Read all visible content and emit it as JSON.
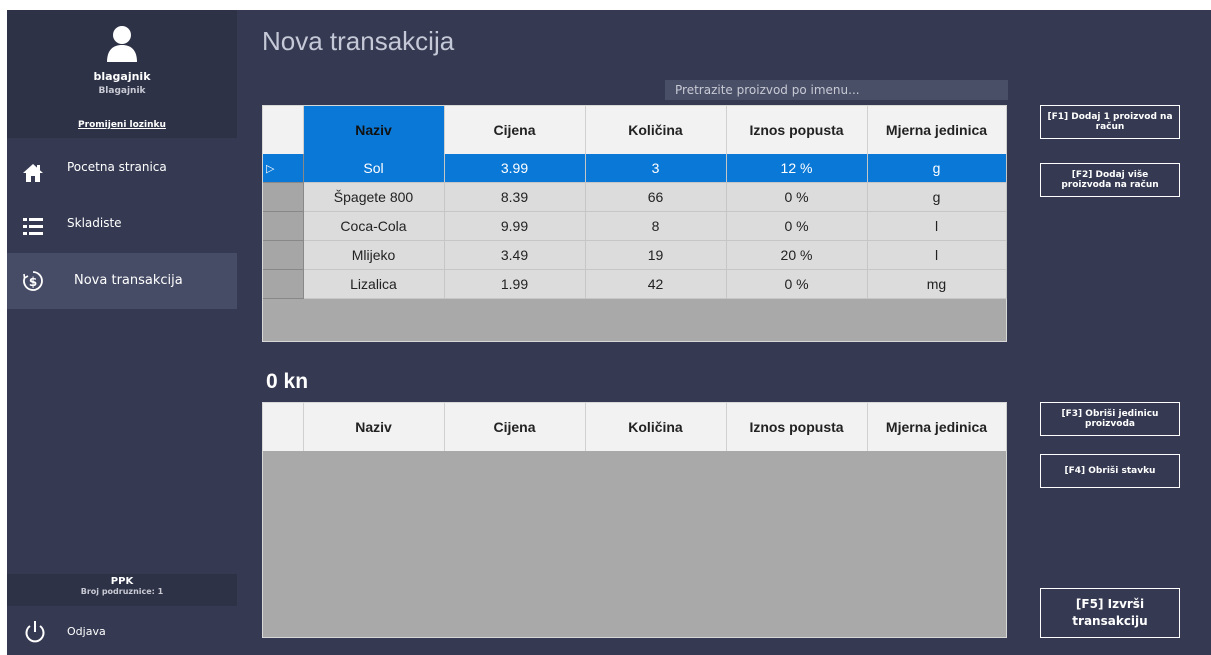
{
  "user": {
    "name": "blagajnik",
    "role": "Blagajnik",
    "change_password": "Promijeni lozinku"
  },
  "nav": [
    {
      "label": "Pocetna stranica",
      "icon": "home-icon"
    },
    {
      "label": "Skladiste",
      "icon": "list-icon"
    },
    {
      "label": "Nova transakcija",
      "icon": "money-icon"
    }
  ],
  "branch": {
    "name": "PPK",
    "number": "Broj podruznice: 1"
  },
  "logout": {
    "label": "Odjava",
    "icon": "power-icon"
  },
  "page_title": "Nova transakcija",
  "search": {
    "placeholder": "Pretrazite proizvod po imenu...",
    "value": ""
  },
  "columns": [
    "Naziv",
    "Cijena",
    "Količina",
    "Iznos popusta",
    "Mjerna jedinica"
  ],
  "products": [
    [
      "Sol",
      "3.99",
      "3",
      "12 %",
      "g"
    ],
    [
      "Špagete 800",
      "8.39",
      "66",
      "0 %",
      "g"
    ],
    [
      "Coca-Cola",
      "9.99",
      "8",
      "0 %",
      "l"
    ],
    [
      "Mlijeko",
      "3.49",
      "19",
      "20 %",
      "l"
    ],
    [
      "Lizalica",
      "1.99",
      "42",
      "0 %",
      "mg"
    ]
  ],
  "selected_marker": "▷",
  "total": "0 kn",
  "buttons": {
    "f1": "[F1] Dodaj 1 proizvod na račun",
    "f2": "[F2] Dodaj više proizvoda na račun",
    "f3": "[F3] Obriši jedinicu proizvoda",
    "f4": "[F4] Obriši stavku",
    "f5": "[F5] Izvrši transakciju"
  },
  "colors": {
    "background": "#353a52",
    "accent": "#0a78d7",
    "sidebar_dark": "#2e3246",
    "sidebar_active": "#474c66"
  }
}
